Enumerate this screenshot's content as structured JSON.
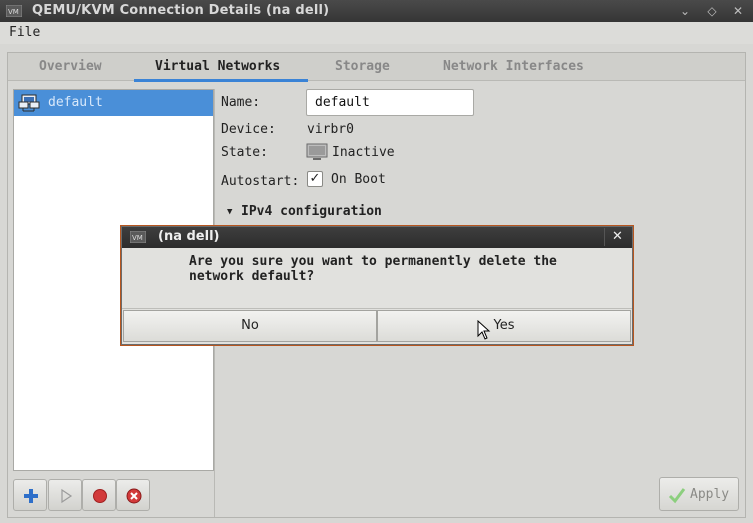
{
  "window": {
    "title": "QEMU/KVM Connection Details (na dell)",
    "icon": "vm-icon"
  },
  "menu": {
    "file": "File"
  },
  "tabs": [
    {
      "label": "Overview",
      "active": false
    },
    {
      "label": "Virtual Networks",
      "active": true
    },
    {
      "label": "Storage",
      "active": false
    },
    {
      "label": "Network Interfaces",
      "active": false
    }
  ],
  "networks": [
    {
      "name": "default",
      "icon": "network-icon",
      "selected": true
    }
  ],
  "details": {
    "name_label": "Name:",
    "name_value": "default",
    "device_label": "Device:",
    "device_value": "virbr0",
    "state_label": "State:",
    "state_value": "Inactive",
    "autostart_label": "Autostart:",
    "autostart_value": "On Boot",
    "autostart_checked": true,
    "ipv4_heading": "IPv4 configuration"
  },
  "toolbar": {
    "buttons": [
      "add-network-button",
      "start-network-button",
      "stop-network-button",
      "delete-network-button"
    ],
    "apply": "Apply"
  },
  "dialog": {
    "title": "(na dell)",
    "message_line1": "Are you sure you want to permanently delete the",
    "message_line2": "network default?",
    "no": "No",
    "yes": "Yes"
  },
  "colors": {
    "selection": "#4a8fd8",
    "tab_underline": "#3a83d6",
    "titlebar": "#353535"
  }
}
